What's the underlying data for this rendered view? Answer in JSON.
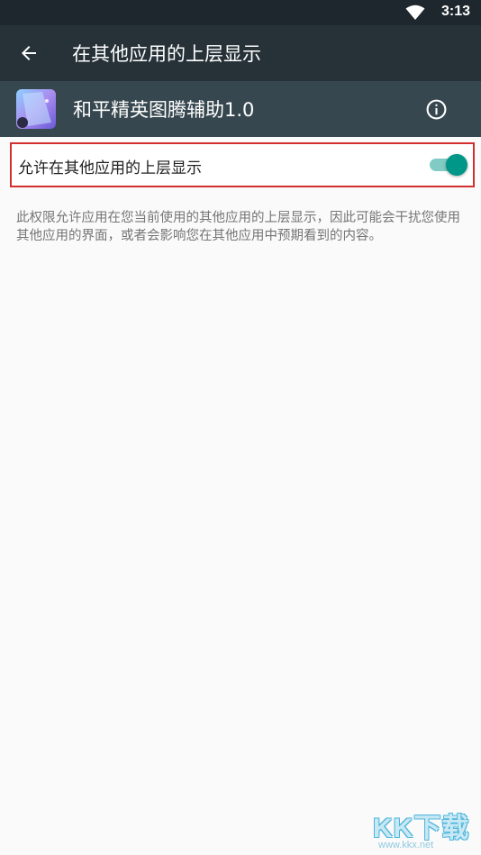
{
  "status_bar": {
    "time": "3:13",
    "wifi_icon": "wifi-icon"
  },
  "toolbar": {
    "title": "在其他应用的上层显示",
    "back_icon": "arrow-back-icon"
  },
  "app": {
    "name": "和平精英图腾辅助1.0",
    "info_icon": "info-icon"
  },
  "permission": {
    "label": "允许在其他应用的上层显示",
    "enabled": true
  },
  "description": "此权限允许应用在您当前使用的其他应用的上层显示，因此可能会干扰您使用其他应用的界面，或者会影响您在其他应用中预期看到的内容。",
  "watermark": {
    "text": "KK下载",
    "url": "www.kkx.net"
  },
  "colors": {
    "status_bar": "#1d272d",
    "toolbar": "#263238",
    "app_header": "#37474f",
    "accent": "#009688",
    "highlight_border": "#d32f2f"
  }
}
